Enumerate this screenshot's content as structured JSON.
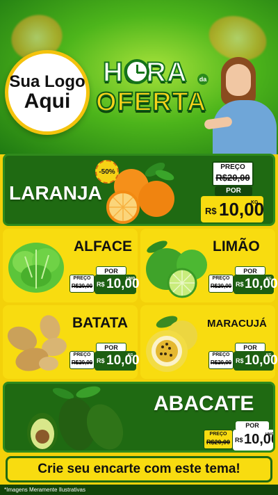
{
  "header": {
    "logo_line1": "Sua Logo",
    "logo_line2": "Aqui",
    "hora": "HORA",
    "da": "da",
    "oferta": "OFERTA"
  },
  "products": {
    "laranja": {
      "name": "LARANJA",
      "discount": "-50%",
      "preco_label": "PREÇO",
      "old_price": "R$20,00",
      "por_label": "POR",
      "currency": "R$",
      "price": "10,00",
      "unit": "KG"
    },
    "alface": {
      "name": "ALFACE",
      "preco_label": "PREÇO",
      "old_price": "R$20,00",
      "por_label": "POR",
      "currency": "R$",
      "price": "10,00",
      "unit": "UNID"
    },
    "limao": {
      "name": "LIMÃO",
      "preco_label": "PREÇO",
      "old_price": "R$20,00",
      "por_label": "POR",
      "currency": "R$",
      "price": "10,00",
      "unit": "KG"
    },
    "batata": {
      "name": "BATATA",
      "preco_label": "PREÇO",
      "old_price": "R$20,00",
      "por_label": "POR",
      "currency": "R$",
      "price": "10,00",
      "unit": "KG"
    },
    "maracuja": {
      "name": "MARACUJÁ",
      "preco_label": "PREÇO",
      "old_price": "R$20,00",
      "por_label": "POR",
      "currency": "R$",
      "price": "10,00",
      "unit": "KG"
    },
    "abacate": {
      "name": "ABACATE",
      "preco_label": "PREÇO",
      "old_price": "R$20,00",
      "por_label": "POR",
      "currency": "R$",
      "price": "10,00",
      "unit": "UNID"
    }
  },
  "footer": {
    "banner": "Crie seu encarte com este tema!",
    "disclaimer": "*Imagens Meramente Ilustrativas"
  },
  "colors": {
    "dark_green": "#1f6a12",
    "yellow": "#f8dc10",
    "bright_green": "#4db51b"
  }
}
